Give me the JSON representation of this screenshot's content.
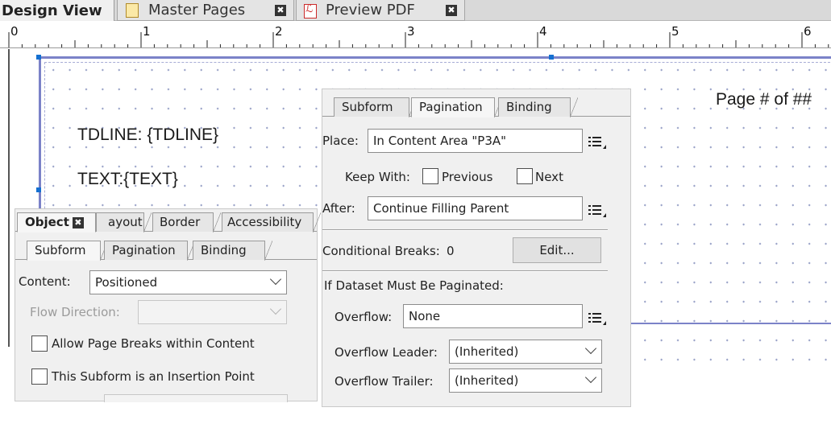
{
  "document_tabs": [
    {
      "label": "Design View",
      "active": true
    },
    {
      "label": "Master Pages",
      "active": false,
      "close": "✖"
    },
    {
      "label": "Preview PDF",
      "active": false,
      "close": "✖"
    }
  ],
  "ruler": {
    "marks": [
      "0",
      "1",
      "2",
      "3",
      "4",
      "5",
      "6"
    ]
  },
  "canvas": {
    "page_number_text": "Page # of ##",
    "tdline_text": "TDLINE: {TDLINE}",
    "text_field": "TEXT:{TEXT}"
  },
  "object_panel": {
    "top_tabs": [
      "Object",
      "ayout",
      "Border",
      "Accessibility"
    ],
    "top_close": "✖",
    "sub_tabs": [
      "Subform",
      "Pagination",
      "Binding"
    ],
    "content_label": "Content:",
    "content_value": "Positioned",
    "flow_direction_label": "Flow Direction:",
    "flow_direction_value": "",
    "allow_page_breaks_label": "Allow Page Breaks within Content",
    "insertion_point_label": "This Subform is an Insertion Point"
  },
  "pagination_panel": {
    "tabs": [
      "Subform",
      "Pagination",
      "Binding"
    ],
    "active_tab": "Pagination",
    "place_label": "Place:",
    "place_value": "In Content Area \"P3A\"",
    "keep_with_label": "Keep With:",
    "previous_label": "Previous",
    "next_label": "Next",
    "after_label": "After:",
    "after_value": "Continue Filling Parent",
    "conditional_breaks_label": "Conditional Breaks:",
    "conditional_breaks_count": "0",
    "edit_button": "Edit...",
    "dataset_heading": "If Dataset Must Be Paginated:",
    "overflow_label": "Overflow:",
    "overflow_value": "None",
    "overflow_leader_label": "Overflow Leader:",
    "overflow_leader_value": "(Inherited)",
    "overflow_trailer_label": "Overflow Trailer:",
    "overflow_trailer_value": "(Inherited)"
  },
  "colors": {
    "content_area_border": "#7b82c8",
    "selection_handle": "#1570d1",
    "panel_background": "#f0f0f0"
  }
}
